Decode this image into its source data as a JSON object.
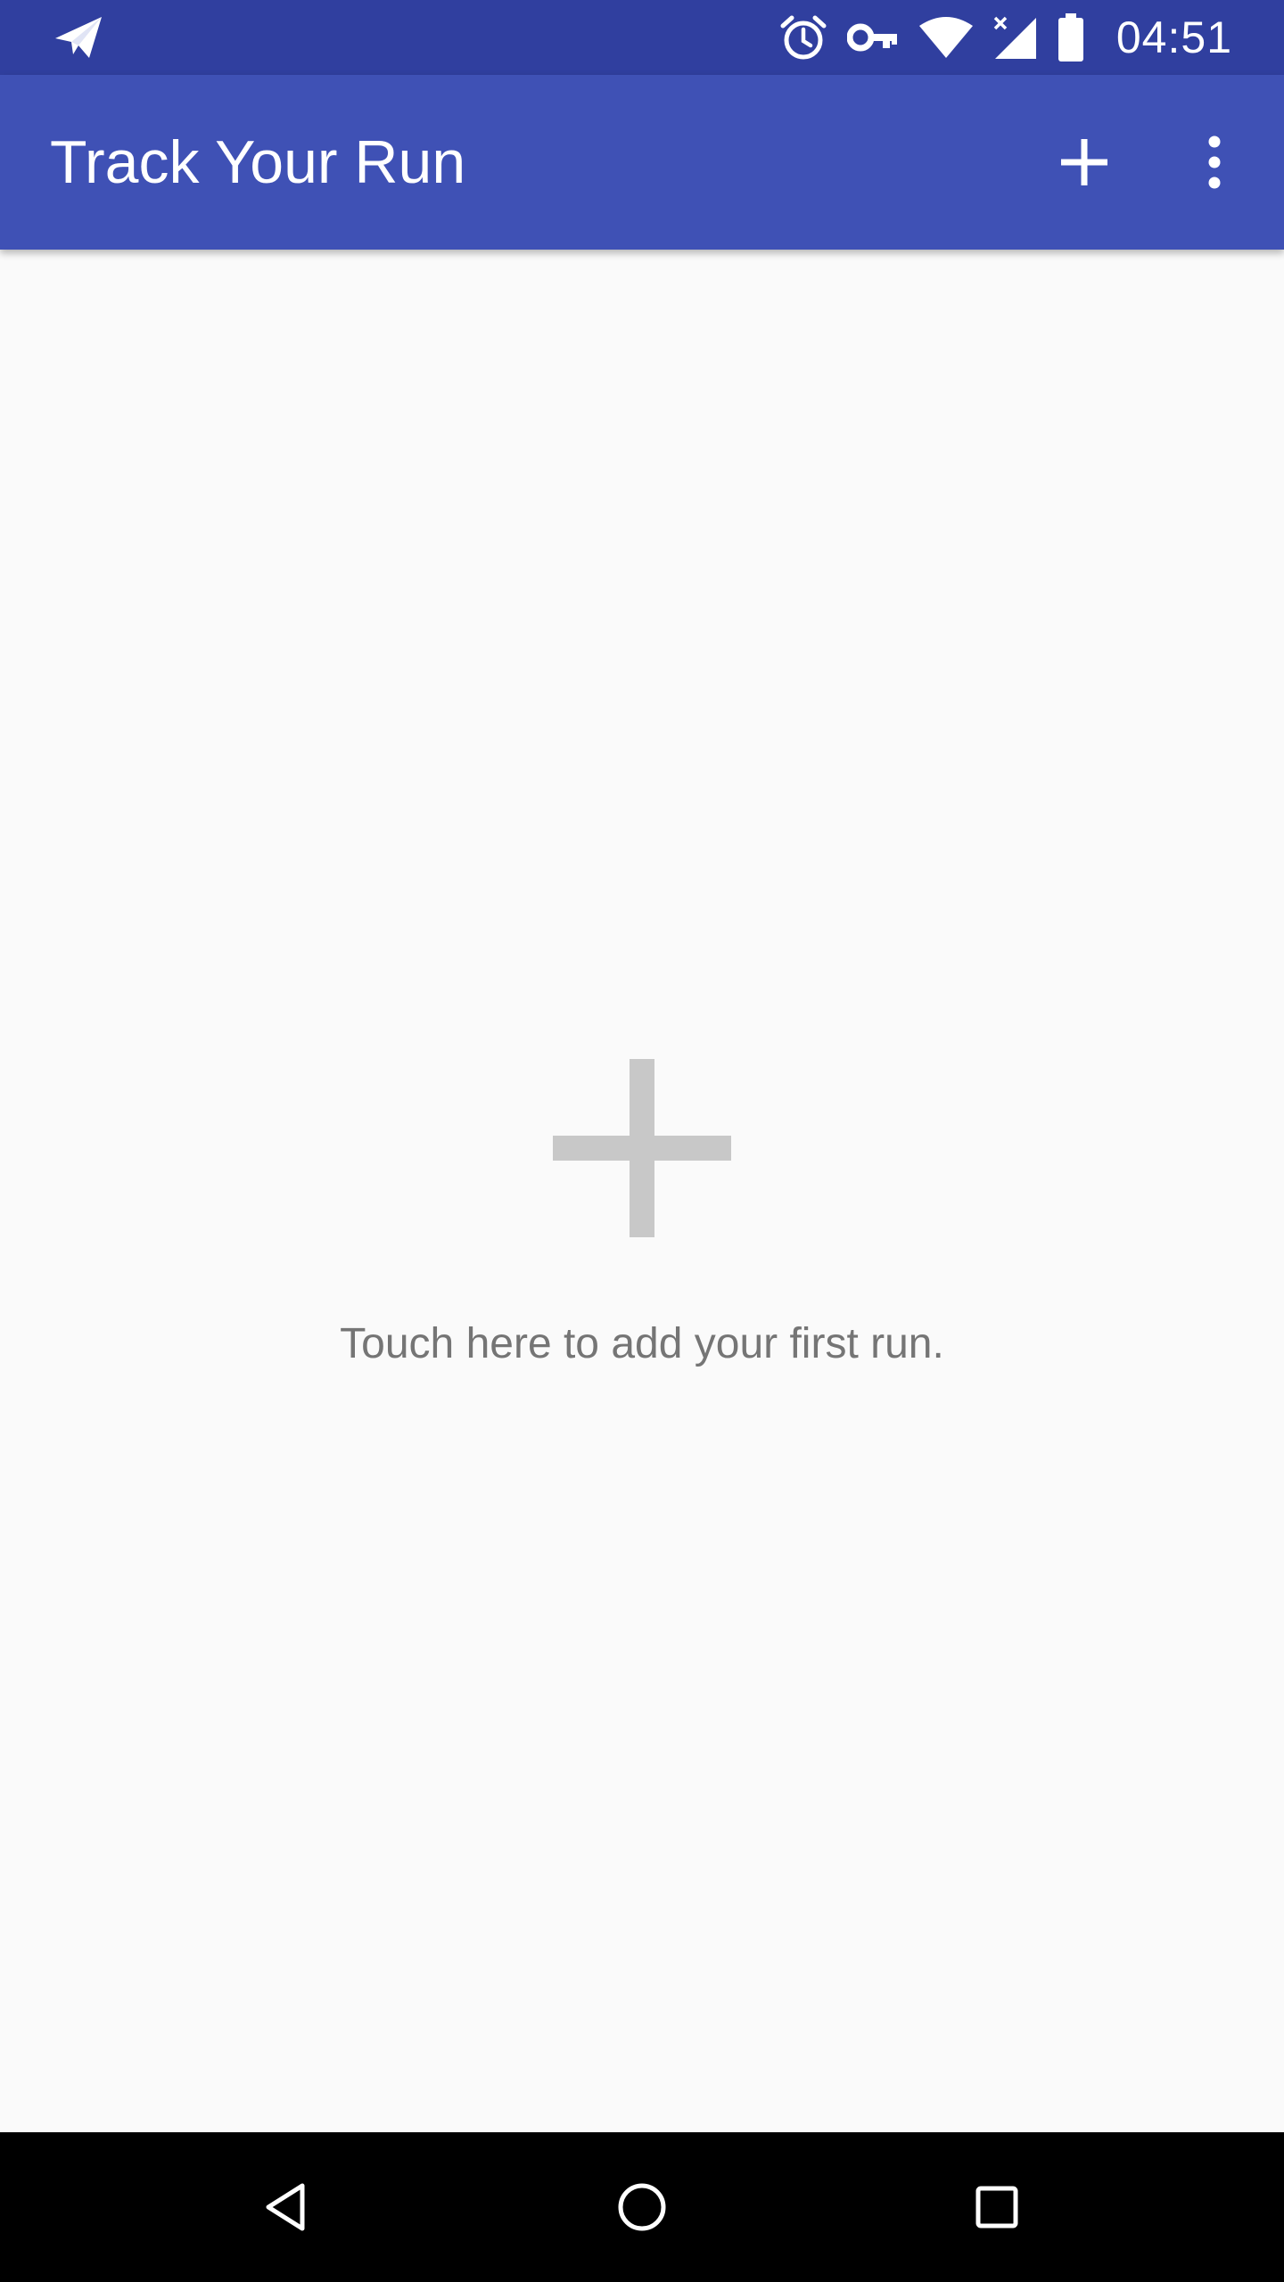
{
  "status_bar": {
    "time": "04:51",
    "icons": [
      "send-icon",
      "alarm-icon",
      "vpn-key-icon",
      "wifi-icon",
      "signal-no-data-icon",
      "battery-icon"
    ]
  },
  "app_bar": {
    "title": "Track Your Run",
    "actions": [
      "add-icon",
      "more-vert-icon"
    ],
    "background": "#3f51b5"
  },
  "empty_state": {
    "icon": "add-icon",
    "message": "Touch here to add your first run."
  },
  "nav_bar": {
    "buttons": [
      "back-icon",
      "home-icon",
      "recents-icon"
    ]
  },
  "colors": {
    "status_bar": "#303f9f",
    "primary": "#3f51b5",
    "background": "#fafafa",
    "empty_icon": "#c8c8c8",
    "empty_text": "#757575"
  }
}
